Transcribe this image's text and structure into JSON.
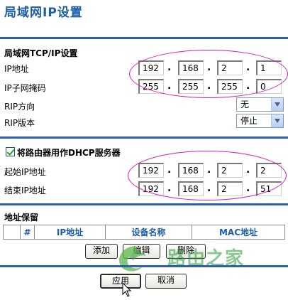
{
  "page": {
    "title": "局域网IP设置"
  },
  "lan": {
    "section_title": "局域网TCP/IP设置",
    "ip_label": "IP地址",
    "ip": [
      "192",
      "168",
      "2",
      "1"
    ],
    "mask_label": "IP子网掩码",
    "mask": [
      "255",
      "255",
      "255",
      "0"
    ],
    "rip_direction_label": "RIP方向",
    "rip_direction_value": "无",
    "rip_version_label": "RIP版本",
    "rip_version_value": "停止"
  },
  "dhcp": {
    "checkbox_label": "将路由器用作DHCP服务器",
    "checked": true,
    "start_label": "起始IP地址",
    "start_ip": [
      "192",
      "168",
      "2",
      "2"
    ],
    "end_label": "结束IP地址",
    "end_ip": [
      "192",
      "168",
      "2",
      "51"
    ]
  },
  "reservation": {
    "section_title": "地址保留",
    "columns": [
      "#",
      "IP地址",
      "设备名称",
      "MAC地址"
    ],
    "add_label": "添加",
    "edit_label": "编辑",
    "delete_label": "删除"
  },
  "footer": {
    "apply_label": "应用",
    "cancel_label": "取消"
  },
  "watermark": {
    "text": "路由之家"
  },
  "colors": {
    "title": "#1d5ea8",
    "rule": "#2d5faa",
    "highlight": "#d01ab8",
    "watermark": "#2a9a3a"
  }
}
